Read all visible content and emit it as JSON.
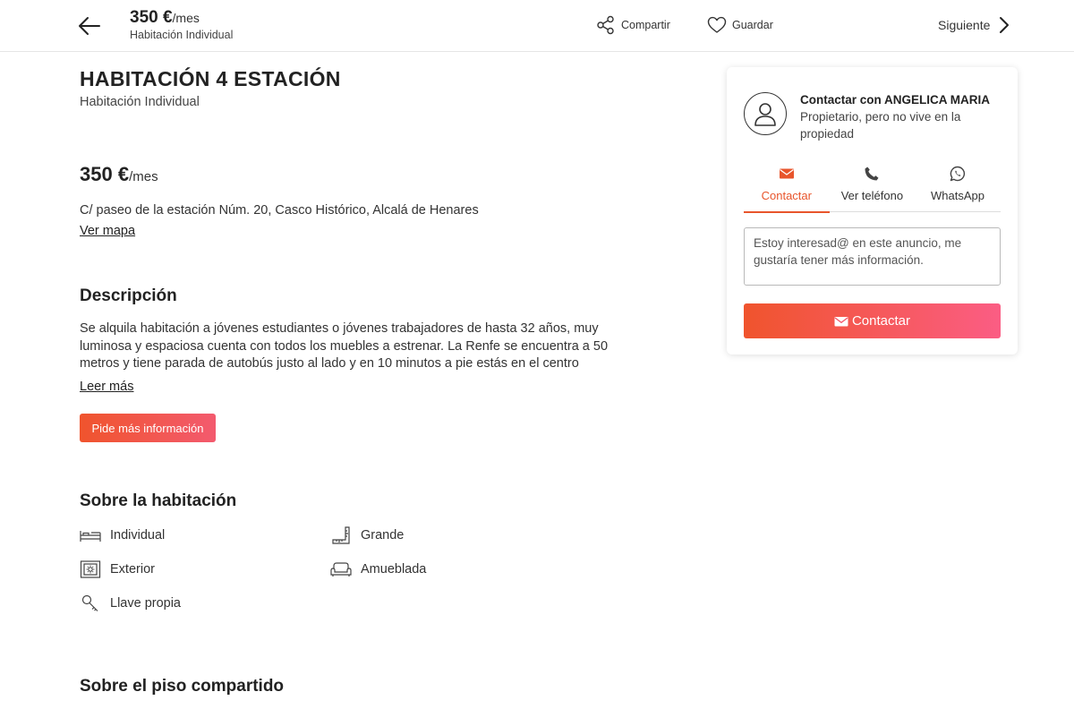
{
  "header": {
    "price": "350 €",
    "price_unit": "/mes",
    "subtitle": "Habitación Individual",
    "share_label": "Compartir",
    "save_label": "Guardar",
    "next_label": "Siguiente"
  },
  "listing": {
    "title": "HABITACIÓN 4 ESTACIÓN",
    "subtitle": "Habitación Individual",
    "price": "350 €",
    "price_unit": "/mes",
    "address": "C/ paseo de la estación Núm. 20, Casco Histórico, Alcalá de Henares",
    "map_link": "Ver mapa"
  },
  "description": {
    "title": "Descripción",
    "text": "Se alquila habitación a jóvenes estudiantes o jóvenes trabajadores de hasta 32 años, muy luminosa y espaciosa cuenta con todos los muebles a estrenar. La Renfe se encuentra a 50 metros y tiene parada de autobús justo al lado y en 10 minutos a pie estás en el centro",
    "read_more": "Leer más",
    "info_button": "Pide más información"
  },
  "room": {
    "title": "Sobre la habitación",
    "features": [
      {
        "label": "Individual",
        "icon": "bed-icon"
      },
      {
        "label": "Grande",
        "icon": "ruler-icon"
      },
      {
        "label": "Exterior",
        "icon": "window-icon"
      },
      {
        "label": "Amueblada",
        "icon": "sofa-icon"
      },
      {
        "label": "Llave propia",
        "icon": "key-icon"
      }
    ]
  },
  "shared": {
    "title": "Sobre el piso compartido"
  },
  "contact": {
    "owner_name": "Contactar con ANGELICA MARIA",
    "owner_role": "Propietario, pero no vive en la propiedad",
    "tabs": [
      {
        "label": "Contactar",
        "icon": "envelope-icon",
        "active": true
      },
      {
        "label": "Ver teléfono",
        "icon": "phone-icon",
        "active": false
      },
      {
        "label": "WhatsApp",
        "icon": "whatsapp-icon",
        "active": false
      }
    ],
    "message": "Estoy interesad@ en este anuncio, me gustaría tener más información.",
    "button_label": "Contactar"
  },
  "colors": {
    "accent": "#e8552c",
    "gradient_start": "#f0542d",
    "gradient_end": "#fb5d84"
  }
}
